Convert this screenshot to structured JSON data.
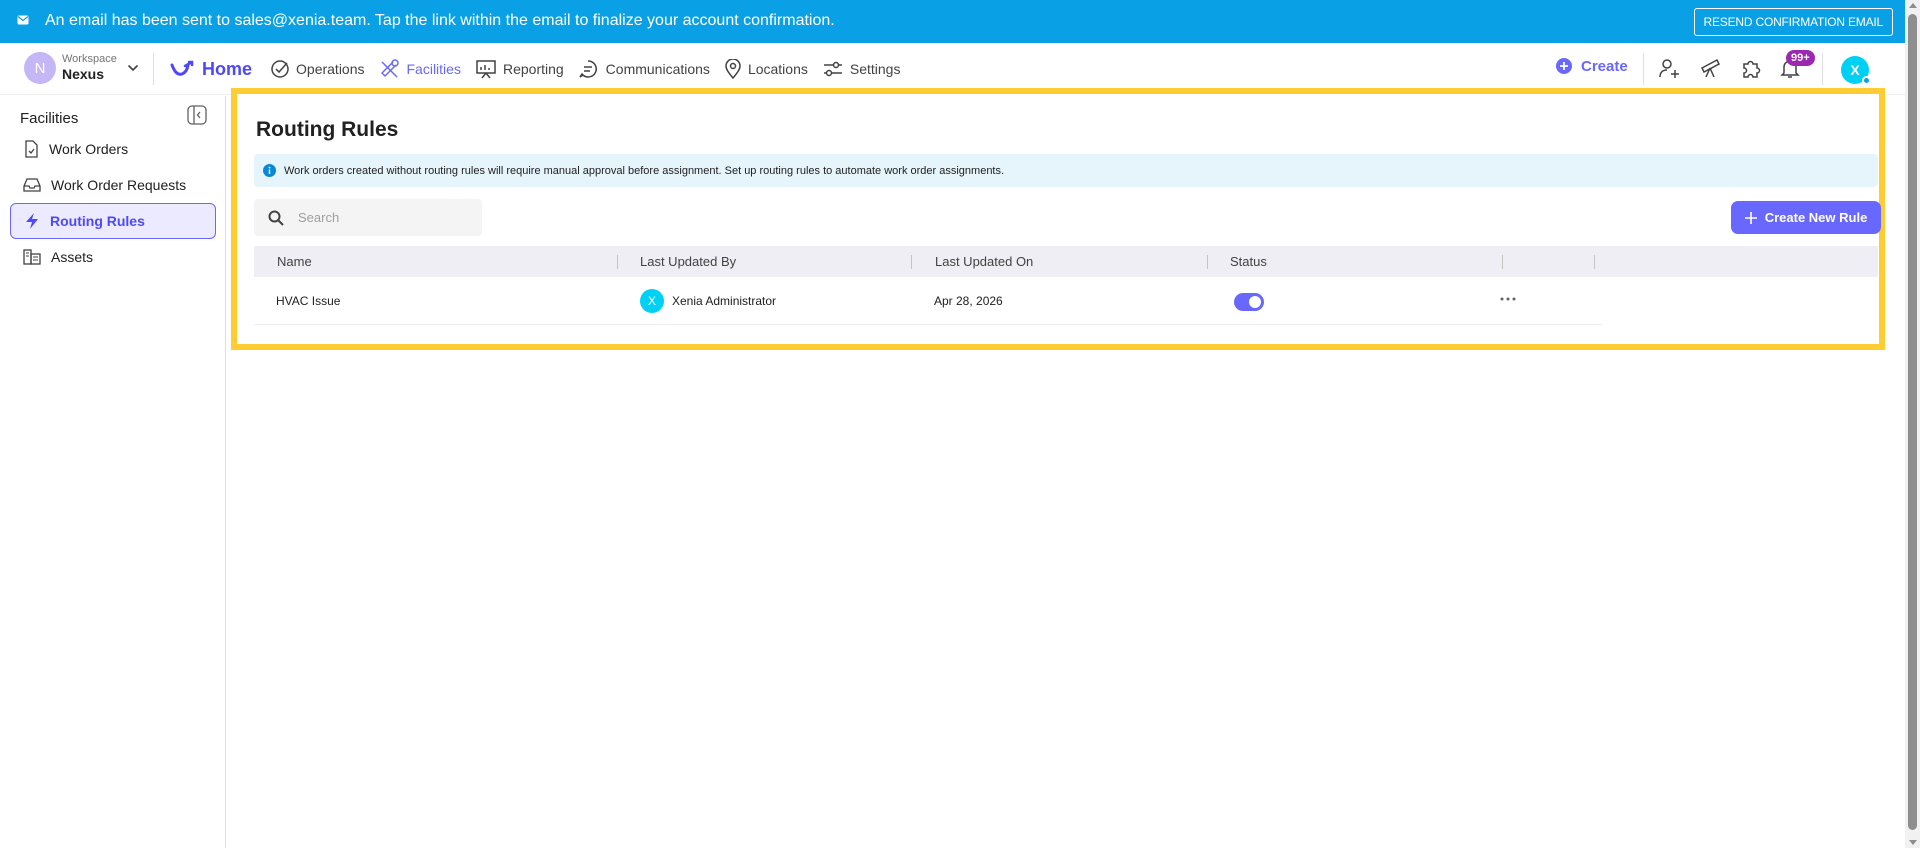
{
  "banner": {
    "message": "An email has been sent to sales@xenia.team. Tap the link within the email to finalize your account confirmation.",
    "resend_label": "RESEND CONFIRMATION EMAIL",
    "icon": "mail-icon",
    "bg_color": "#0AA0E6"
  },
  "topnav": {
    "workspace_initial": "N",
    "workspace_label": "Workspace",
    "workspace_name": "Nexus",
    "items": [
      {
        "label": "Home",
        "icon": "home-logo-icon"
      },
      {
        "label": "Operations",
        "icon": "check-circle-icon"
      },
      {
        "label": "Facilities",
        "icon": "tools-icon",
        "active": true
      },
      {
        "label": "Reporting",
        "icon": "presentation-chart-icon"
      },
      {
        "label": "Communications",
        "icon": "chat-icon"
      },
      {
        "label": "Locations",
        "icon": "location-pin-icon"
      },
      {
        "label": "Settings",
        "icon": "sliders-icon"
      }
    ],
    "create_label": "Create",
    "notification_badge": "99+",
    "user_initial": "X",
    "accent_color": "#6868FE"
  },
  "sidebar": {
    "title": "Facilities",
    "items": [
      {
        "label": "Work Orders",
        "icon": "clipboard-icon"
      },
      {
        "label": "Work Order Requests",
        "icon": "inbox-icon"
      },
      {
        "label": "Routing Rules",
        "icon": "lightning-icon",
        "active": true
      },
      {
        "label": "Assets",
        "icon": "assets-icon"
      }
    ]
  },
  "main": {
    "title": "Routing Rules",
    "info_text": "Work orders created without routing rules will require manual approval before assignment. Set up routing rules to automate work order assignments.",
    "search_placeholder": "Search",
    "create_rule_label": "Create New Rule",
    "columns": [
      "Name",
      "Last Updated By",
      "Last Updated On",
      "Status"
    ],
    "rows": [
      {
        "name": "HVAC Issue",
        "updated_by_initial": "X",
        "updated_by": "Xenia Administrator",
        "updated_on": "Apr 28, 2026",
        "status_enabled": true
      }
    ],
    "highlight_color": "#FFCD32"
  }
}
